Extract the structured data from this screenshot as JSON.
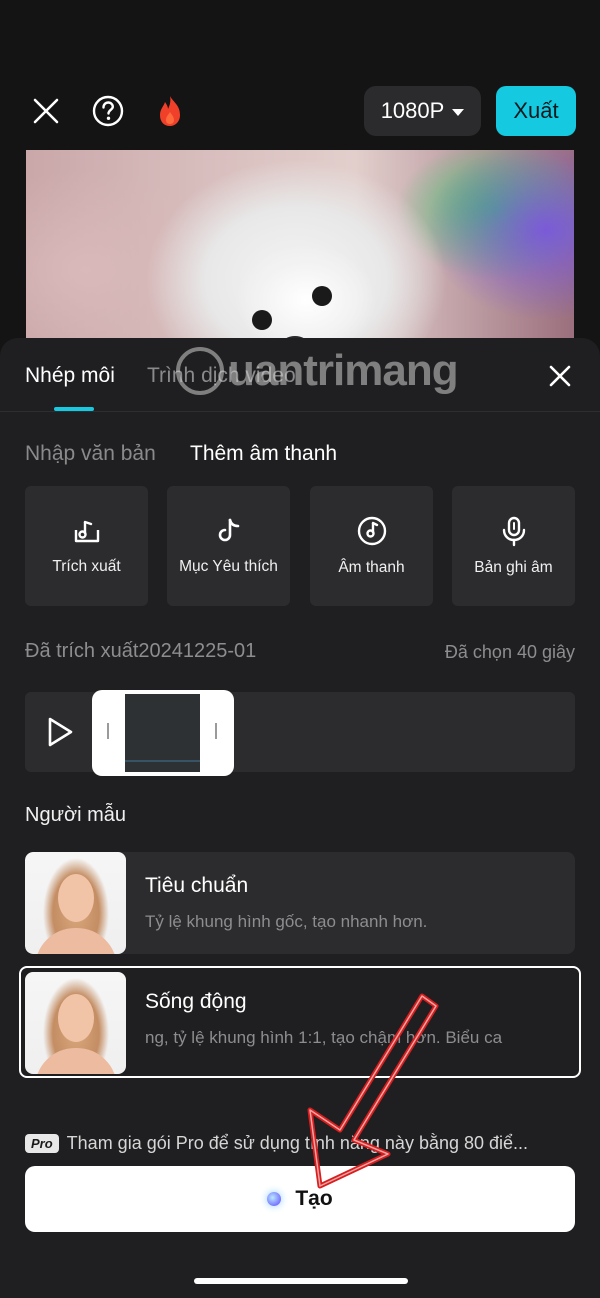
{
  "topbar": {
    "close_icon": "close-icon",
    "help_icon": "help-icon",
    "flame_icon": "flame-icon",
    "resolution": "1080P",
    "export_label": "Xuất",
    "accent": "#15c9e0"
  },
  "sheet": {
    "tabs": [
      {
        "label": "Nhép môi"
      },
      {
        "label": "Trình dịch video"
      }
    ],
    "watermark": "uantrimang",
    "subtabs": [
      {
        "label": "Nhập văn bản"
      },
      {
        "label": "Thêm âm thanh"
      }
    ],
    "audio_sources": [
      {
        "label": "Trích xuất",
        "icon": "extract-icon"
      },
      {
        "label": "Mục Yêu thích",
        "icon": "tiktok-favorite-icon"
      },
      {
        "label": "Âm thanh",
        "icon": "music-disc-icon"
      },
      {
        "label": "Bản ghi âm",
        "icon": "microphone-icon"
      }
    ],
    "extracted_name": "Đã trích xuất20241225-01",
    "selected_duration": "Đã chọn 40 giây",
    "models_title": "Người mẫu",
    "models": [
      {
        "title": "Tiêu chuẩn",
        "desc": "Tỷ lệ khung hình gốc, tạo nhanh hơn."
      },
      {
        "title": "Sống động",
        "desc": "ng, tỷ lệ khung hình 1:1, tạo chậm hơn.    Biểu ca"
      }
    ],
    "pro_badge": "Pro",
    "pro_text": "Tham gia gói Pro để sử dụng tính năng này bằng 80 điể...",
    "create_label": "Tạo"
  }
}
